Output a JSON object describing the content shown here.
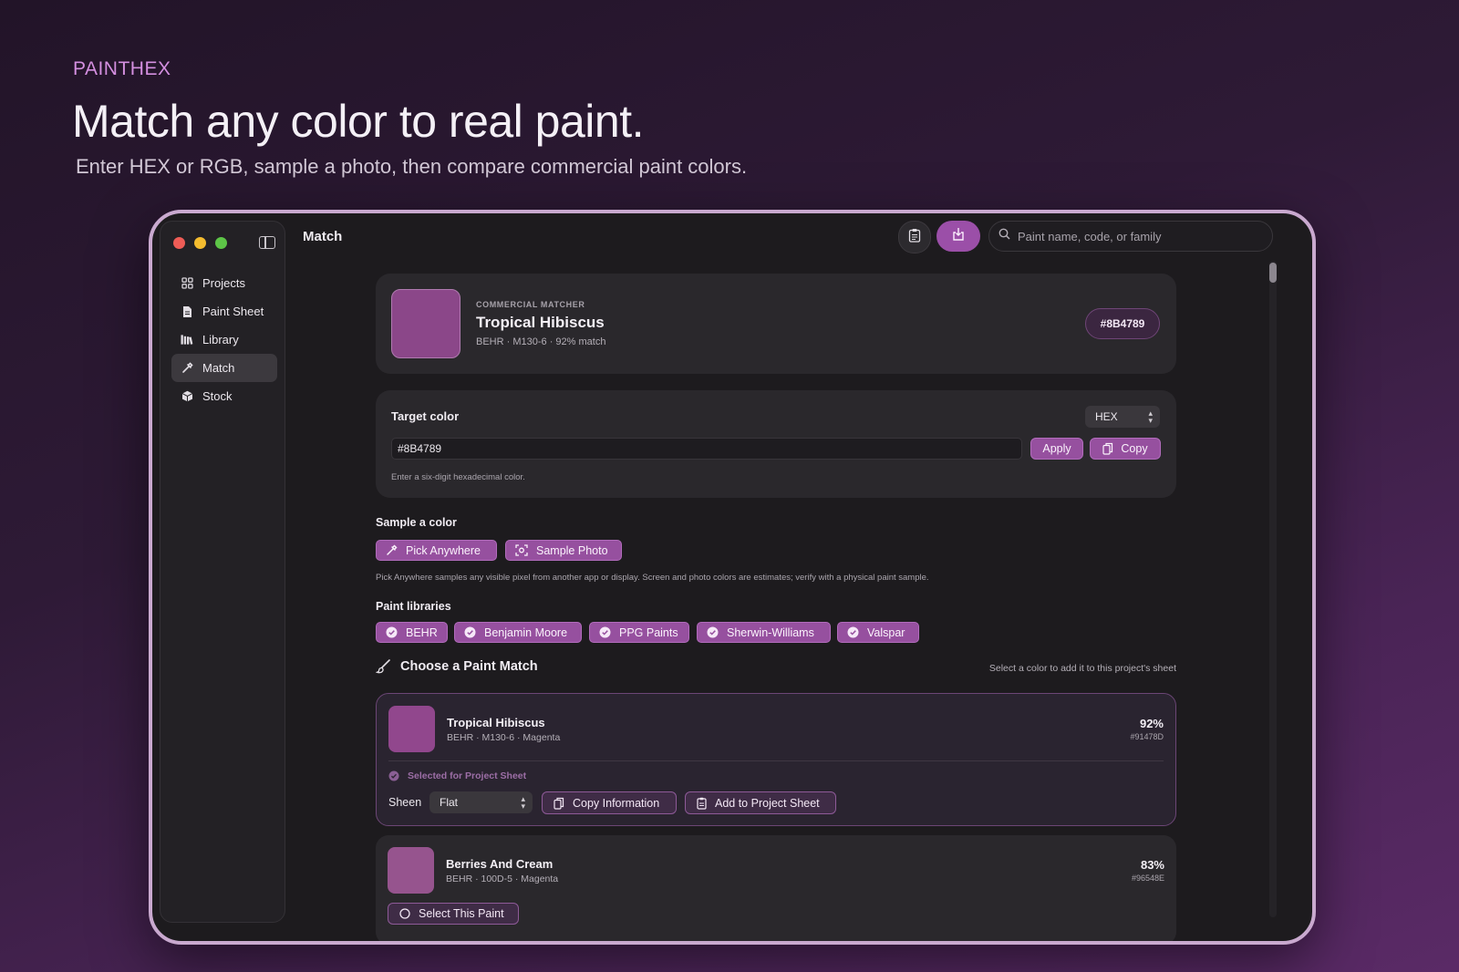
{
  "hero": {
    "brand": "PAINTHEX",
    "title": "Match any color to real paint.",
    "subtitle": "Enter HEX or RGB, sample a photo, then compare commercial paint colors."
  },
  "window": {
    "title": "Match"
  },
  "sidebar": {
    "items": [
      {
        "label": "Projects",
        "icon": "grid-icon"
      },
      {
        "label": "Paint Sheet",
        "icon": "document-icon"
      },
      {
        "label": "Library",
        "icon": "books-icon"
      },
      {
        "label": "Match",
        "icon": "eyedropper-icon",
        "active": true
      },
      {
        "label": "Stock",
        "icon": "box-icon"
      }
    ]
  },
  "toolbar": {
    "search_placeholder": "Paint name, code, or family",
    "accent": "#9b4fa8"
  },
  "best_match": {
    "eyebrow": "COMMERCIAL MATCHER",
    "name": "Tropical Hibiscus",
    "meta": "BEHR · M130-6 · 92% match",
    "hex": "#8B4789",
    "swatch_color": "#8b4789"
  },
  "target": {
    "label": "Target color",
    "format": "HEX",
    "value": "#8B4789",
    "apply_label": "Apply",
    "copy_label": "Copy",
    "help": "Enter a six-digit hexadecimal color."
  },
  "sample": {
    "label": "Sample a color",
    "pick_label": "Pick Anywhere",
    "photo_label": "Sample Photo",
    "note": "Pick Anywhere samples any visible pixel from another app or display. Screen and photo colors are estimates; verify with a physical paint sample."
  },
  "libraries": {
    "label": "Paint libraries",
    "items": [
      "BEHR",
      "Benjamin Moore",
      "PPG Paints",
      "Sherwin-Williams",
      "Valspar"
    ]
  },
  "matches": {
    "heading": "Choose a Paint Match",
    "hint": "Select a color to add it to this project's sheet",
    "items": [
      {
        "name": "Tropical Hibiscus",
        "meta": "BEHR · M130-6 · Magenta",
        "percent": "92%",
        "code": "#91478D",
        "swatch_color": "#91478d",
        "selected_label": "Selected for Project Sheet",
        "sheen_label": "Sheen",
        "sheen_value": "Flat",
        "copy_info_label": "Copy Information",
        "add_label": "Add to Project Sheet"
      },
      {
        "name": "Berries And Cream",
        "meta": "BEHR · 100D-5 · Magenta",
        "percent": "83%",
        "code": "#96548E",
        "swatch_color": "#96548e",
        "select_label": "Select This Paint"
      }
    ]
  }
}
